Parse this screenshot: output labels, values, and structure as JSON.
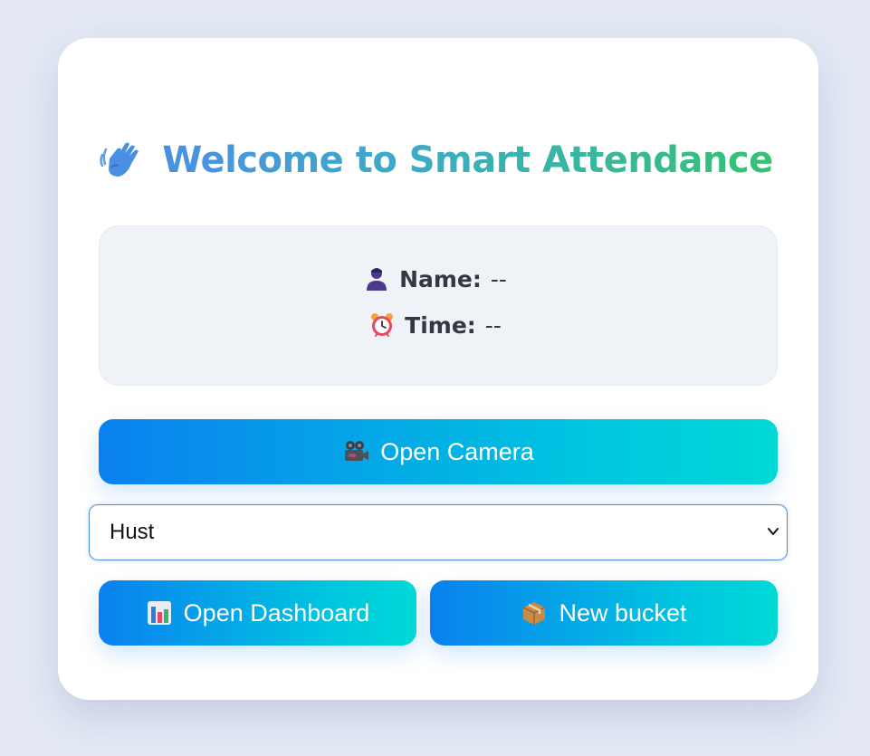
{
  "header": {
    "title": "Welcome to Smart Attendance",
    "icon": "waving-hand-icon"
  },
  "info": {
    "name_label": "Name:",
    "name_value": "--",
    "name_icon": "person-icon",
    "time_label": "Time:",
    "time_value": "--",
    "time_icon": "alarm-clock-icon"
  },
  "buttons": {
    "camera_label": "Open Camera",
    "camera_icon": "video-camera-icon",
    "dashboard_label": "Open Dashboard",
    "dashboard_icon": "bar-chart-icon",
    "bucket_label": "New bucket",
    "bucket_icon": "package-icon"
  },
  "bucket_select": {
    "selected": "Hust"
  },
  "colors": {
    "background": "#e4e9f5",
    "card": "#ffffff",
    "title_gradient_start": "#4a90e2",
    "title_gradient_end": "#35c271",
    "button_gradient_start": "#0a80ef",
    "button_gradient_end": "#00d9d6",
    "info_box": "#eff2f7",
    "select_border": "#4a8fd8"
  }
}
